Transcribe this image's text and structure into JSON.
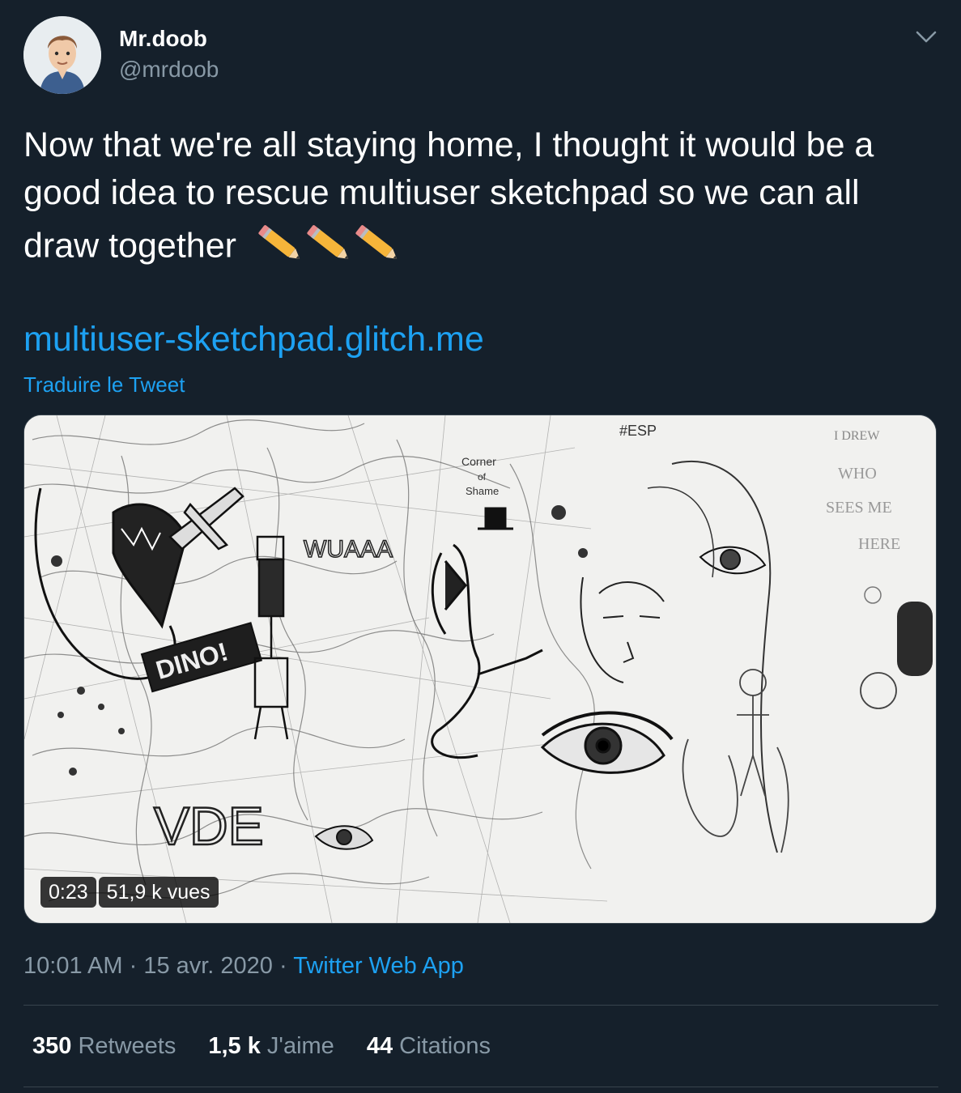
{
  "author": {
    "display_name": "Mr.doob",
    "handle": "@mrdoob"
  },
  "tweet": {
    "text": "Now that we're all staying home, I thought it would be a good idea to rescue multiuser sketchpad so we can all draw together",
    "emoji": "pencil x3",
    "link": "multiuser-sketchpad.glitch.me",
    "translate_label": "Traduire le Tweet"
  },
  "media": {
    "duration": "0:23",
    "views": "51,9 k vues",
    "drawing_texts": [
      "DINO!",
      "VDE",
      "WHO SEES ME HERE",
      "#ESP",
      "Corner of Shame",
      "WUAAA",
      "I DREW"
    ]
  },
  "meta": {
    "time": "10:01 AM",
    "separator": " · ",
    "date": "15 avr. 2020",
    "app": "Twitter Web App"
  },
  "stats": [
    {
      "num": "350",
      "label": "Retweets"
    },
    {
      "num": "1,5 k",
      "label": "J'aime"
    },
    {
      "num": "44",
      "label": "Citations"
    }
  ],
  "colors": {
    "background": "#15202b",
    "accent": "#1da1f2",
    "secondary_text": "#8899a6",
    "border": "#38444d"
  }
}
